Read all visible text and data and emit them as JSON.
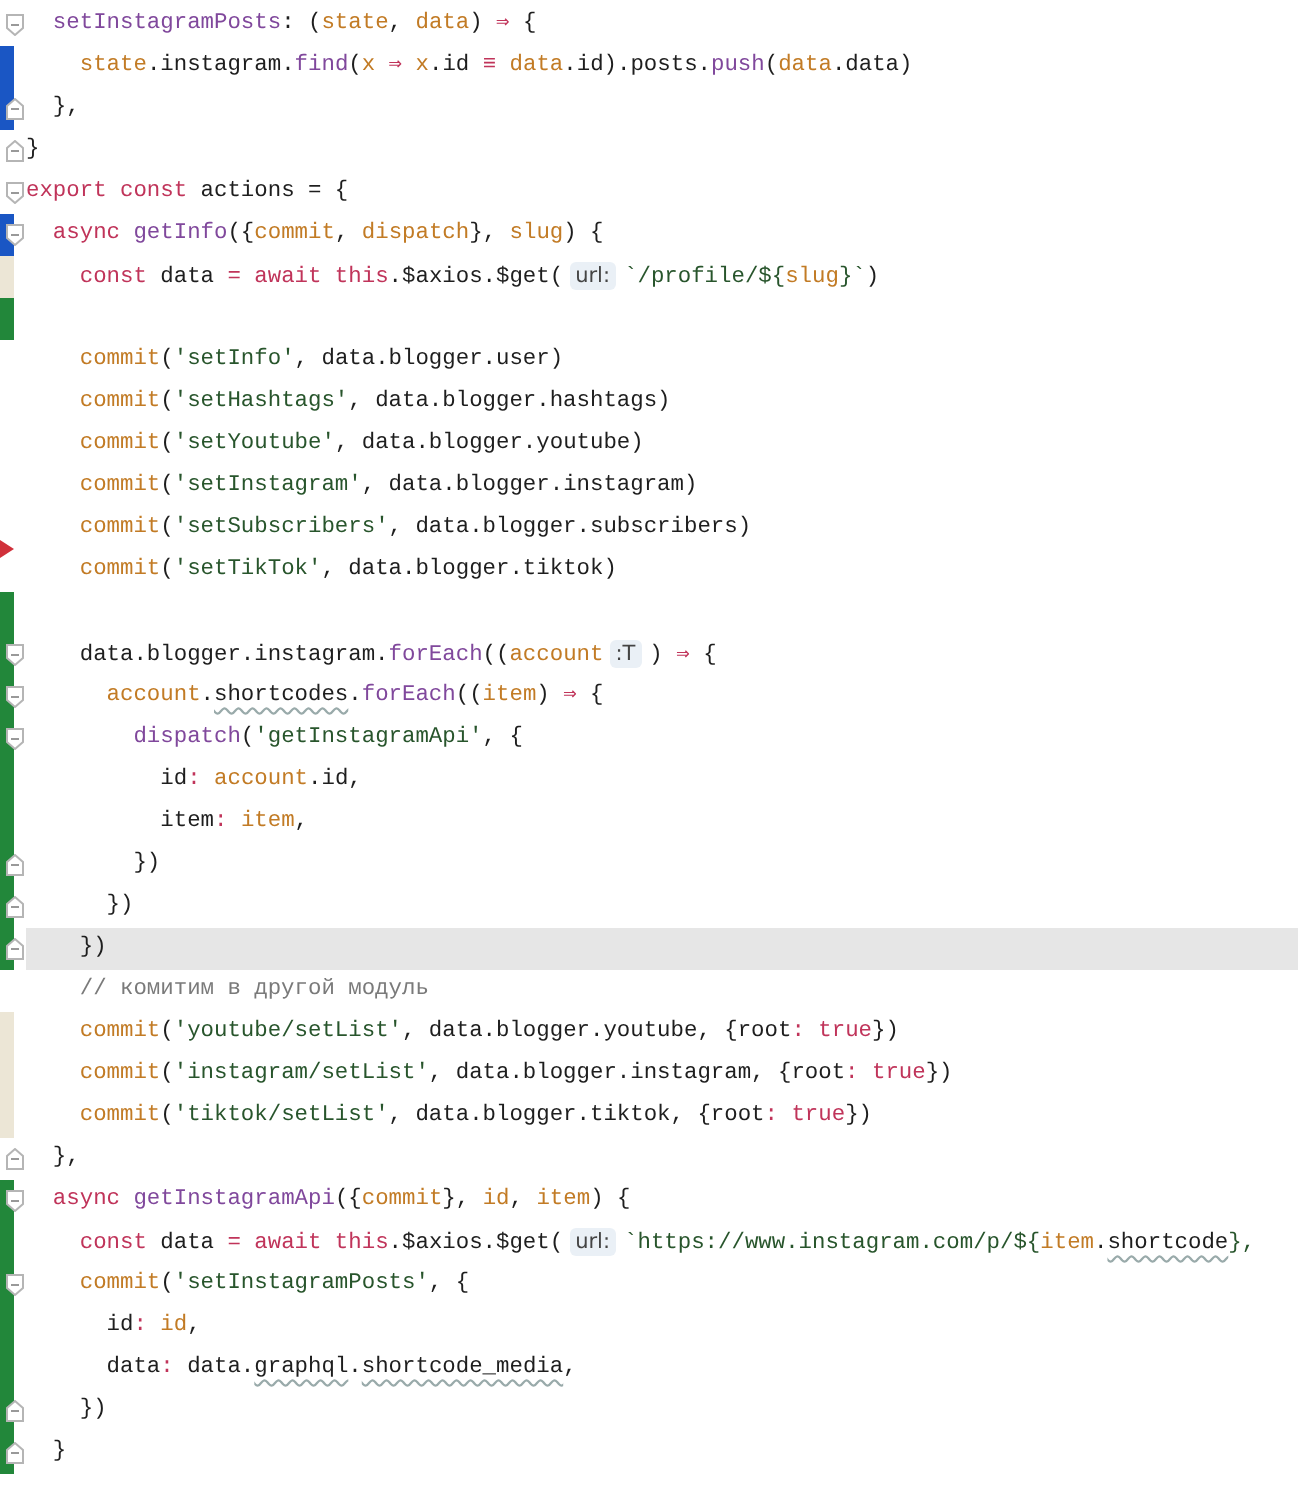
{
  "lines": [
    {
      "deleted_above": false,
      "fold_open": true,
      "fold_close": false,
      "current": false,
      "tokens": [
        {
          "kind": "fn",
          "text": "  setInstagramPosts"
        },
        {
          "kind": "p",
          "text": ": ("
        },
        {
          "kind": "v",
          "text": "state"
        },
        {
          "kind": "p",
          "text": ", "
        },
        {
          "kind": "v",
          "text": "data"
        },
        {
          "kind": "p",
          "text": ") "
        },
        {
          "kind": "op",
          "text": "⇒"
        },
        {
          "kind": "p",
          "text": " {"
        }
      ]
    },
    {
      "deleted_above": false,
      "fold_open": false,
      "fold_close": false,
      "current": false,
      "color": "#1a56c4",
      "tokens": [
        {
          "kind": "v",
          "text": "    state"
        },
        {
          "kind": "p",
          "text": ".instagram."
        },
        {
          "kind": "fn",
          "text": "find"
        },
        {
          "kind": "p",
          "text": "("
        },
        {
          "kind": "v",
          "text": "x"
        },
        {
          "kind": "op",
          "text": " ⇒ "
        },
        {
          "kind": "v",
          "text": "x"
        },
        {
          "kind": "p",
          "text": ".id "
        },
        {
          "kind": "op",
          "text": "≡"
        },
        {
          "kind": "v",
          "text": " data"
        },
        {
          "kind": "p",
          "text": ".id).posts."
        },
        {
          "kind": "fn",
          "text": "push"
        },
        {
          "kind": "p",
          "text": "("
        },
        {
          "kind": "v",
          "text": "data"
        },
        {
          "kind": "p",
          "text": ".data)"
        }
      ]
    },
    {
      "deleted_above": false,
      "fold_open": false,
      "fold_close": true,
      "current": false,
      "color": "#1a56c4",
      "tokens": [
        {
          "kind": "p",
          "text": "  },"
        }
      ]
    },
    {
      "deleted_above": false,
      "fold_open": false,
      "fold_close": true,
      "current": false,
      "tokens": [
        {
          "kind": "p",
          "text": "}"
        }
      ]
    },
    {
      "deleted_above": false,
      "fold_open": true,
      "fold_close": false,
      "current": false,
      "tokens": [
        {
          "kind": "kw",
          "text": "export const "
        },
        {
          "kind": "p",
          "text": "actions = {"
        }
      ]
    },
    {
      "deleted_above": false,
      "fold_open": true,
      "fold_close": false,
      "current": false,
      "color": "#1a56c4",
      "tokens": [
        {
          "kind": "kw",
          "text": "  async "
        },
        {
          "kind": "fn",
          "text": "getInfo"
        },
        {
          "kind": "p",
          "text": "({"
        },
        {
          "kind": "v",
          "text": "commit"
        },
        {
          "kind": "p",
          "text": ", "
        },
        {
          "kind": "v",
          "text": "dispatch"
        },
        {
          "kind": "p",
          "text": "}, "
        },
        {
          "kind": "v",
          "text": "slug"
        },
        {
          "kind": "p",
          "text": ") {"
        }
      ]
    },
    {
      "deleted_above": false,
      "fold_open": false,
      "fold_close": false,
      "current": false,
      "color": "#ece6d6",
      "tokens": [
        {
          "kind": "kw",
          "text": "    const "
        },
        {
          "kind": "p",
          "text": "data "
        },
        {
          "kind": "kw",
          "text": "= await this"
        },
        {
          "kind": "p",
          "text": ".$axios.$get("
        },
        {
          "kind": "h",
          "text": "url:"
        },
        {
          "kind": "s",
          "text": "`/profile/${"
        },
        {
          "kind": "v",
          "text": "slug"
        },
        {
          "kind": "s",
          "text": "}`"
        },
        {
          "kind": "p",
          "text": ")"
        }
      ]
    },
    {
      "deleted_above": false,
      "fold_open": false,
      "fold_close": false,
      "current": false,
      "color": "#22873a"
    },
    {
      "deleted_above": false,
      "fold_open": false,
      "fold_close": false,
      "current": false,
      "tokens": [
        {
          "kind": "v",
          "text": "    commit"
        },
        {
          "kind": "p",
          "text": "("
        },
        {
          "kind": "s",
          "text": "'setInfo'"
        },
        {
          "kind": "p",
          "text": ", data.blogger.user)"
        }
      ]
    },
    {
      "deleted_above": false,
      "fold_open": false,
      "fold_close": false,
      "current": false,
      "tokens": [
        {
          "kind": "v",
          "text": "    commit"
        },
        {
          "kind": "p",
          "text": "("
        },
        {
          "kind": "s",
          "text": "'setHashtags'"
        },
        {
          "kind": "p",
          "text": ", data.blogger.hashtags)"
        }
      ]
    },
    {
      "deleted_above": false,
      "fold_open": false,
      "fold_close": false,
      "current": false,
      "tokens": [
        {
          "kind": "v",
          "text": "    commit"
        },
        {
          "kind": "p",
          "text": "("
        },
        {
          "kind": "s",
          "text": "'setYoutube'"
        },
        {
          "kind": "p",
          "text": ", data.blogger.youtube)"
        }
      ]
    },
    {
      "deleted_above": false,
      "fold_open": false,
      "fold_close": false,
      "current": false,
      "tokens": [
        {
          "kind": "v",
          "text": "    commit"
        },
        {
          "kind": "p",
          "text": "("
        },
        {
          "kind": "s",
          "text": "'setInstagram'"
        },
        {
          "kind": "p",
          "text": ", data.blogger.instagram)"
        }
      ]
    },
    {
      "deleted_above": false,
      "fold_open": false,
      "fold_close": false,
      "current": false,
      "tokens": [
        {
          "kind": "v",
          "text": "    commit"
        },
        {
          "kind": "p",
          "text": "("
        },
        {
          "kind": "s",
          "text": "'setSubscribers'"
        },
        {
          "kind": "p",
          "text": ", data.blogger.subscribers)"
        }
      ]
    },
    {
      "deleted_above": true,
      "fold_open": false,
      "fold_close": false,
      "current": false,
      "tokens": [
        {
          "kind": "v",
          "text": "    commit"
        },
        {
          "kind": "p",
          "text": "("
        },
        {
          "kind": "s",
          "text": "'setTikTok'"
        },
        {
          "kind": "p",
          "text": ", data.blogger.tiktok)"
        }
      ]
    },
    {
      "deleted_above": false,
      "fold_open": false,
      "fold_close": false,
      "current": false,
      "color": "#22873a"
    },
    {
      "deleted_above": false,
      "fold_open": true,
      "fold_close": false,
      "current": false,
      "color": "#22873a",
      "tokens": [
        {
          "kind": "p",
          "text": "    data.blogger.instagram."
        },
        {
          "kind": "fn",
          "text": "forEach"
        },
        {
          "kind": "p",
          "text": "(("
        },
        {
          "kind": "v",
          "text": "account"
        },
        {
          "kind": "h",
          "text": ":T"
        },
        {
          "kind": "p",
          "text": ") "
        },
        {
          "kind": "op",
          "text": "⇒"
        },
        {
          "kind": "p",
          "text": " {"
        }
      ]
    },
    {
      "deleted_above": false,
      "fold_open": true,
      "fold_close": false,
      "current": false,
      "color": "#22873a",
      "tokens": [
        {
          "kind": "v",
          "text": "      account"
        },
        {
          "kind": "p",
          "text": "."
        },
        {
          "kind": "t",
          "text": "shortcodes"
        },
        {
          "kind": "p",
          "text": "."
        },
        {
          "kind": "fn",
          "text": "forEach"
        },
        {
          "kind": "p",
          "text": "(("
        },
        {
          "kind": "v",
          "text": "item"
        },
        {
          "kind": "p",
          "text": ") "
        },
        {
          "kind": "op",
          "text": "⇒"
        },
        {
          "kind": "p",
          "text": " {"
        }
      ]
    },
    {
      "deleted_above": false,
      "fold_open": true,
      "fold_close": false,
      "current": false,
      "color": "#22873a",
      "tokens": [
        {
          "kind": "fn",
          "text": "        dispatch"
        },
        {
          "kind": "p",
          "text": "("
        },
        {
          "kind": "s",
          "text": "'getInstagramApi'"
        },
        {
          "kind": "p",
          "text": ", {"
        }
      ]
    },
    {
      "deleted_above": false,
      "fold_open": false,
      "fold_close": false,
      "current": false,
      "color": "#22873a",
      "tokens": [
        {
          "kind": "p",
          "text": "          id"
        },
        {
          "kind": "op",
          "text": ": "
        },
        {
          "kind": "v",
          "text": "account"
        },
        {
          "kind": "p",
          "text": ".id,"
        }
      ]
    },
    {
      "deleted_above": false,
      "fold_open": false,
      "fold_close": false,
      "current": false,
      "color": "#22873a",
      "tokens": [
        {
          "kind": "p",
          "text": "          item"
        },
        {
          "kind": "op",
          "text": ": "
        },
        {
          "kind": "v",
          "text": "item"
        },
        {
          "kind": "p",
          "text": ","
        }
      ]
    },
    {
      "deleted_above": false,
      "fold_open": false,
      "fold_close": true,
      "current": false,
      "color": "#22873a",
      "tokens": [
        {
          "kind": "p",
          "text": "        })"
        }
      ]
    },
    {
      "deleted_above": false,
      "fold_open": false,
      "fold_close": true,
      "current": false,
      "color": "#22873a",
      "tokens": [
        {
          "kind": "p",
          "text": "      })"
        }
      ]
    },
    {
      "deleted_above": false,
      "fold_open": false,
      "fold_close": true,
      "current": true,
      "color": "#22873a",
      "tokens": [
        {
          "kind": "p",
          "text": "    })"
        }
      ]
    },
    {
      "deleted_above": false,
      "fold_open": false,
      "fold_close": false,
      "current": false,
      "tokens": [
        {
          "kind": "c",
          "text": "    // комитим в другой модуль"
        }
      ]
    },
    {
      "deleted_above": false,
      "fold_open": false,
      "fold_close": false,
      "current": false,
      "color": "#ece6d6",
      "tokens": [
        {
          "kind": "v",
          "text": "    commit"
        },
        {
          "kind": "p",
          "text": "("
        },
        {
          "kind": "s",
          "text": "'youtube/setList'"
        },
        {
          "kind": "p",
          "text": ", data.blogger.youtube, {root"
        },
        {
          "kind": "op",
          "text": ": "
        },
        {
          "kind": "kw",
          "text": "true"
        },
        {
          "kind": "p",
          "text": "})"
        }
      ]
    },
    {
      "deleted_above": false,
      "fold_open": false,
      "fold_close": false,
      "current": false,
      "color": "#ece6d6",
      "tokens": [
        {
          "kind": "v",
          "text": "    commit"
        },
        {
          "kind": "p",
          "text": "("
        },
        {
          "kind": "s",
          "text": "'instagram/setList'"
        },
        {
          "kind": "p",
          "text": ", data.blogger.instagram, {root"
        },
        {
          "kind": "op",
          "text": ": "
        },
        {
          "kind": "kw",
          "text": "true"
        },
        {
          "kind": "p",
          "text": "})"
        }
      ]
    },
    {
      "deleted_above": false,
      "fold_open": false,
      "fold_close": false,
      "current": false,
      "color": "#ece6d6",
      "tokens": [
        {
          "kind": "v",
          "text": "    commit"
        },
        {
          "kind": "p",
          "text": "("
        },
        {
          "kind": "s",
          "text": "'tiktok/setList'"
        },
        {
          "kind": "p",
          "text": ", data.blogger.tiktok, {root"
        },
        {
          "kind": "op",
          "text": ": "
        },
        {
          "kind": "kw",
          "text": "true"
        },
        {
          "kind": "p",
          "text": "})"
        }
      ]
    },
    {
      "deleted_above": false,
      "fold_open": false,
      "fold_close": true,
      "current": false,
      "tokens": [
        {
          "kind": "p",
          "text": "  },"
        }
      ]
    },
    {
      "deleted_above": false,
      "fold_open": true,
      "fold_close": false,
      "current": false,
      "color": "#22873a",
      "tokens": [
        {
          "kind": "kw",
          "text": "  async "
        },
        {
          "kind": "fn",
          "text": "getInstagramApi"
        },
        {
          "kind": "p",
          "text": "({"
        },
        {
          "kind": "v",
          "text": "commit"
        },
        {
          "kind": "p",
          "text": "}, "
        },
        {
          "kind": "v",
          "text": "id"
        },
        {
          "kind": "p",
          "text": ", "
        },
        {
          "kind": "v",
          "text": "item"
        },
        {
          "kind": "p",
          "text": ") {"
        }
      ]
    },
    {
      "deleted_above": false,
      "fold_open": false,
      "fold_close": false,
      "current": false,
      "color": "#22873a",
      "tokens": [
        {
          "kind": "kw",
          "text": "    const "
        },
        {
          "kind": "p",
          "text": "data "
        },
        {
          "kind": "kw",
          "text": "= await this"
        },
        {
          "kind": "p",
          "text": ".$axios.$get("
        },
        {
          "kind": "h",
          "text": "url:"
        },
        {
          "kind": "s",
          "text": "`https://www.instagram.com/p/${"
        },
        {
          "kind": "v",
          "text": "item"
        },
        {
          "kind": "p",
          "text": "."
        },
        {
          "kind": "t",
          "text": "shortcode"
        },
        {
          "kind": "s",
          "text": "},"
        }
      ]
    },
    {
      "deleted_above": false,
      "fold_open": true,
      "fold_close": false,
      "current": false,
      "color": "#22873a",
      "tokens": [
        {
          "kind": "v",
          "text": "    commit"
        },
        {
          "kind": "p",
          "text": "("
        },
        {
          "kind": "s",
          "text": "'setInstagramPosts'"
        },
        {
          "kind": "p",
          "text": ", {"
        }
      ]
    },
    {
      "deleted_above": false,
      "fold_open": false,
      "fold_close": false,
      "current": false,
      "color": "#22873a",
      "tokens": [
        {
          "kind": "p",
          "text": "      id"
        },
        {
          "kind": "op",
          "text": ": "
        },
        {
          "kind": "v",
          "text": "id"
        },
        {
          "kind": "p",
          "text": ","
        }
      ]
    },
    {
      "deleted_above": false,
      "fold_open": false,
      "fold_close": false,
      "current": false,
      "color": "#22873a",
      "tokens": [
        {
          "kind": "p",
          "text": "      data"
        },
        {
          "kind": "op",
          "text": ": "
        },
        {
          "kind": "p",
          "text": "data."
        },
        {
          "kind": "t",
          "text": "graphql"
        },
        {
          "kind": "p",
          "text": "."
        },
        {
          "kind": "t",
          "text": "shortcode_media"
        },
        {
          "kind": "p",
          "text": ","
        }
      ]
    },
    {
      "deleted_above": false,
      "fold_open": false,
      "fold_close": true,
      "current": false,
      "color": "#22873a",
      "tokens": [
        {
          "kind": "p",
          "text": "    })"
        }
      ]
    },
    {
      "deleted_above": false,
      "fold_open": false,
      "fold_close": true,
      "current": false,
      "color": "#22873a",
      "tokens": [
        {
          "kind": "p",
          "text": "  }"
        }
      ]
    }
  ]
}
